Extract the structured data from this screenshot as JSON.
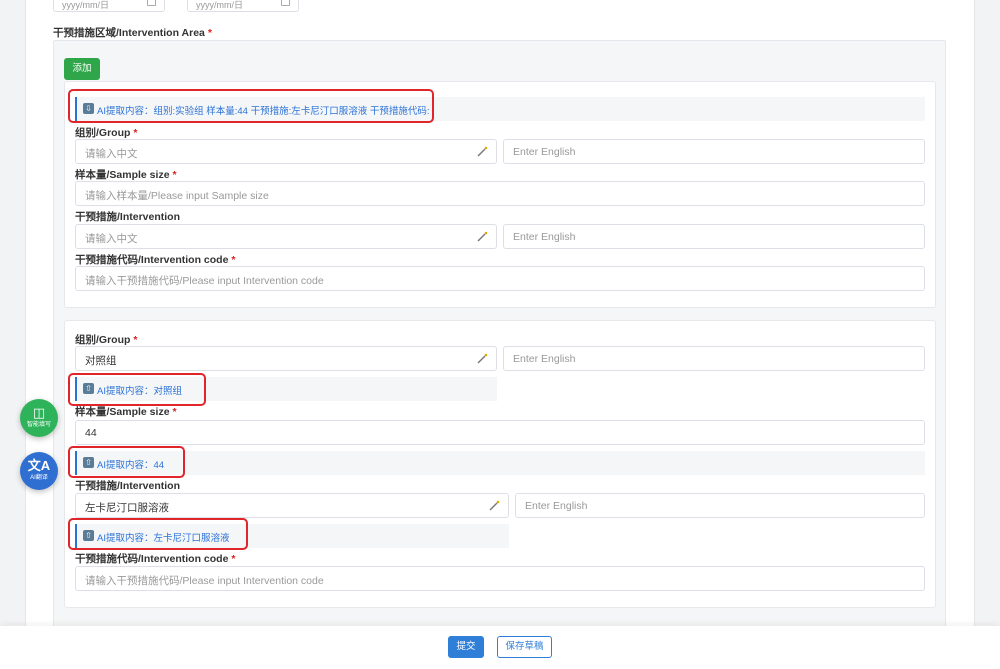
{
  "date_range": {
    "start_placeholder": "yyyy/mm/日",
    "end_placeholder": "yyyy/mm/日"
  },
  "intervention_area": {
    "label": "干预措施区域/Intervention Area",
    "required_mark": "*",
    "add_button": "添加"
  },
  "group1": {
    "ai_summary": "AI提取内容：组别:实验组 样本量:44 干预措施:左卡尼汀口服溶液 干预措施代码:",
    "group_label": "组别/Group",
    "group_cn_placeholder": "请输入中文",
    "group_en_placeholder": "Enter English",
    "sample_label": "样本量/Sample size",
    "sample_placeholder": "请输入样本量/Please input Sample size",
    "intervention_label": "干预措施/Intervention",
    "intervention_cn_placeholder": "请输入中文",
    "intervention_en_placeholder": "Enter English",
    "code_label": "干预措施代码/Intervention code",
    "code_placeholder": "请输入干预措施代码/Please input Intervention code"
  },
  "group2": {
    "group_label": "组别/Group",
    "group_cn_value": "对照组",
    "group_en_placeholder": "Enter English",
    "group_ai": "AI提取内容：对照组",
    "sample_label": "样本量/Sample size",
    "sample_value": "44",
    "sample_ai": "AI提取内容：44",
    "intervention_label": "干预措施/Intervention",
    "intervention_cn_value": "左卡尼汀口服溶液",
    "intervention_en_placeholder": "Enter English",
    "intervention_ai": "AI提取内容：左卡尼汀口服溶液",
    "code_label": "干预措施代码/Intervention code",
    "code_placeholder": "请输入干预措施代码/Please input Intervention code"
  },
  "floating": {
    "smart_fill": "智能填写",
    "ai_translate": "AI翻译",
    "smart_fill_color": "#2fb35a",
    "ai_translate_color": "#2f6fd1"
  },
  "footer": {
    "submit": "提交",
    "save_draft": "保存草稿"
  },
  "colors": {
    "accent_blue": "#2a72d6",
    "add_green": "#2fa64a",
    "required_red": "#e02020",
    "highlight_red": "#e0262b"
  }
}
